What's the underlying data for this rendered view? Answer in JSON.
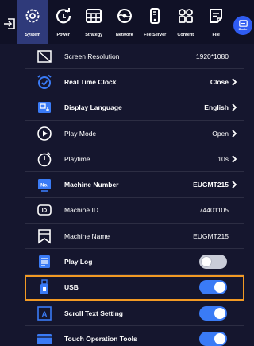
{
  "tabs": [
    {
      "label": "System",
      "icon": "gear-icon",
      "active": true
    },
    {
      "label": "Power",
      "icon": "power-cycle-icon"
    },
    {
      "label": "Strategy",
      "icon": "calendar-grid-icon"
    },
    {
      "label": "Network",
      "icon": "globe-icon"
    },
    {
      "label": "File Server",
      "icon": "server-drive-icon"
    },
    {
      "label": "Content",
      "icon": "grid-icon"
    },
    {
      "label": "File",
      "icon": "file-icon"
    }
  ],
  "basic": {
    "label": "Basic"
  },
  "rows": [
    {
      "label": "Screen Resolution",
      "value": "1920*1080",
      "bold": false,
      "chevron": false,
      "icon": "monitor-icon"
    },
    {
      "label": "Real Time Clock",
      "value": "Close",
      "bold": true,
      "chevron": true,
      "icon": "alarm-clock-icon"
    },
    {
      "label": "Display Language",
      "value": "English",
      "bold": true,
      "chevron": true,
      "icon": "language-icon"
    },
    {
      "label": "Play Mode",
      "value": "Open",
      "bold": false,
      "chevron": true,
      "icon": "play-circle-icon"
    },
    {
      "label": "Playtime",
      "value": "10s",
      "bold": false,
      "chevron": true,
      "icon": "timer-icon"
    },
    {
      "label": "Machine Number",
      "value": "EUGMT215",
      "bold": true,
      "chevron": true,
      "icon": "number-badge-icon"
    },
    {
      "label": "Machine ID",
      "value": "74401105",
      "bold": false,
      "chevron": false,
      "icon": "id-card-icon"
    },
    {
      "label": "Machine Name",
      "value": "EUGMT215",
      "bold": false,
      "chevron": false,
      "icon": "bookmark-icon"
    },
    {
      "label": "Play Log",
      "toggle": "off",
      "bold": true,
      "icon": "log-list-icon"
    },
    {
      "label": "USB",
      "toggle": "on",
      "bold": true,
      "icon": "usb-drive-icon",
      "highlight": true
    },
    {
      "label": "Scroll Text Setting",
      "toggle": "on",
      "bold": true,
      "icon": "text-scroll-icon"
    },
    {
      "label": "Touch Operation Tools",
      "toggle": "on",
      "bold": true,
      "icon": "touch-panel-icon"
    }
  ],
  "colors": {
    "background": "#15162e",
    "accent": "#3a7bf6",
    "highlight": "#f29a24",
    "active_tab": "#2f3a7a"
  }
}
